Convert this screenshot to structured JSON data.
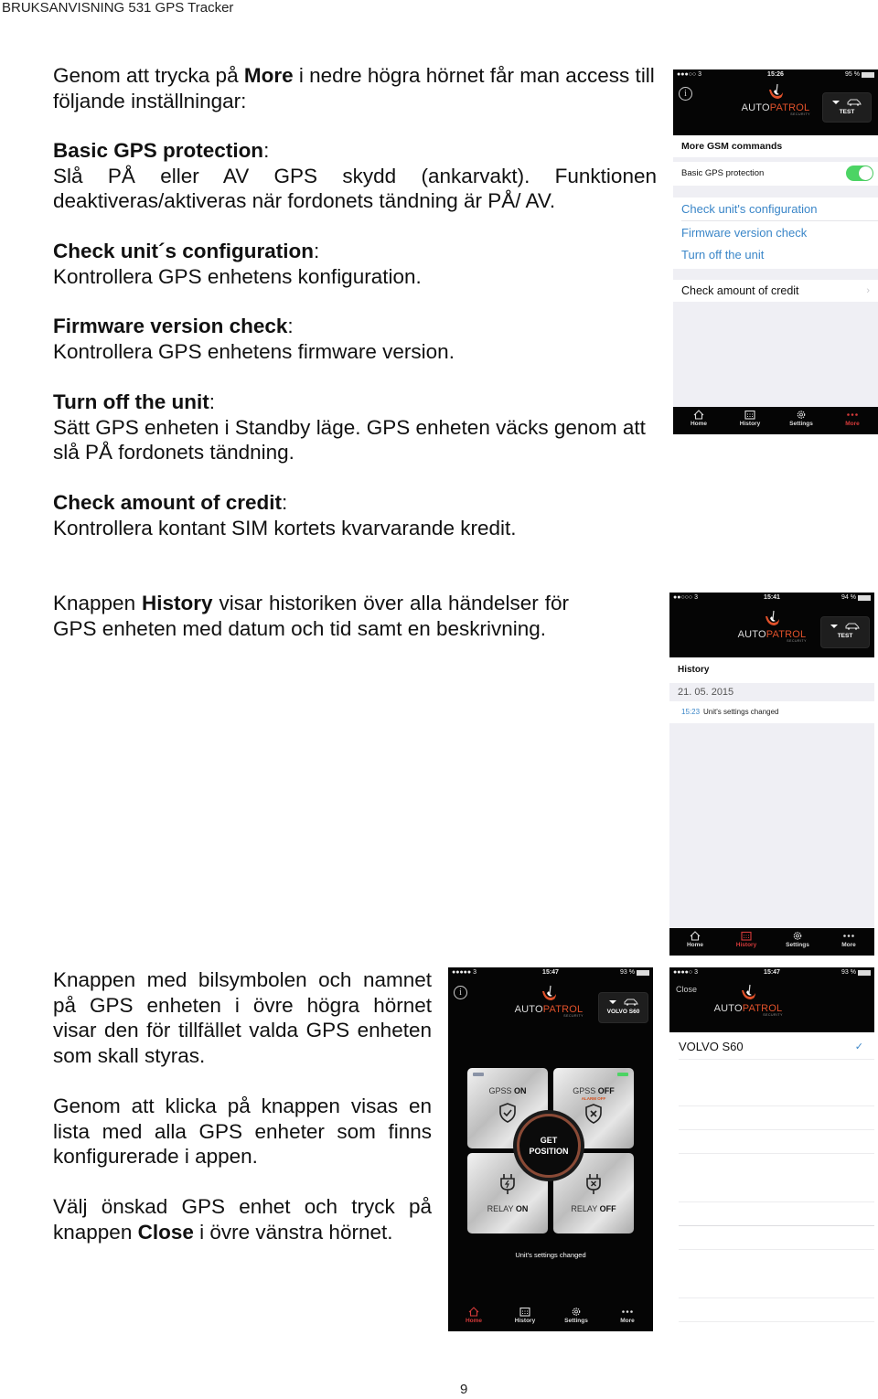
{
  "document": {
    "header": "BRUKSANVISNING 531 GPS Tracker",
    "page_number": "9"
  },
  "intro": {
    "pre": "Genom att trycka på ",
    "bold": "More",
    "post": " i nedre högra hörnet får man access till följande inställningar:"
  },
  "sections": [
    {
      "title": "Basic GPS protection",
      "colon": ":",
      "body": "Slå PÅ eller AV GPS skydd (ankarvakt). Funktionen deaktiveras/aktiveras när fordonets tändning är PÅ/ AV."
    },
    {
      "title": "Check unit´s configuration",
      "colon": ":",
      "body": "Kontrollera GPS enhetens konfiguration."
    },
    {
      "title": "Firmware version check",
      "colon": ":",
      "body": "Kontrollera GPS enhetens firmware version."
    },
    {
      "title": "Turn off the unit",
      "colon": ":",
      "body": "Sätt GPS enheten i Standby läge. GPS enheten väcks genom att slå PÅ fordonets tändning."
    },
    {
      "title": "Check amount of credit",
      "colon": ":",
      "body": "Kontrollera kontant SIM kortets kvarvarande kredit."
    }
  ],
  "history_para": {
    "pre": "Knappen ",
    "bold": "History",
    "post": " visar historiken över alla händelser för GPS enheten med datum och tid samt en beskrivning."
  },
  "unit_paras": [
    {
      "text": "Knappen med bilsymbolen och namnet på GPS enheten i övre högra hörnet visar den för tillfället valda GPS enheten som skall styras."
    },
    {
      "text": "Genom att klicka på knappen visas en lista med alla GPS enheter som finns konfigurerade i appen."
    },
    {
      "pre": "Välj önskad GPS enhet och tryck på knappen ",
      "bold": "Close",
      "post": " i övre vänstra hörnet."
    }
  ],
  "app": {
    "brand_auto": "AUTO",
    "brand_patrol": "PATROL",
    "brand_sub": "SECURITY",
    "info_label": "i",
    "accent_color": "#e0512a",
    "active_tab_color": "#d53a3a",
    "link_color": "#3a86c8",
    "toggle_color": "#4cd464",
    "tabs": [
      "Home",
      "History",
      "Settings",
      "More"
    ]
  },
  "screen_more": {
    "status": {
      "signal": "●●●○○ 3",
      "time": "15:26",
      "battery": "95 %"
    },
    "unit_name": "TEST",
    "section_header": "More GSM commands",
    "toggle_row": {
      "label": "Basic GPS protection",
      "on": true
    },
    "commands": [
      "Check unit's configuration",
      "Firmware version check",
      "Turn off the unit"
    ],
    "credit_row": "Check amount of credit",
    "active_tab": "More"
  },
  "screen_history": {
    "status": {
      "signal": "●●○○○ 3",
      "time": "15:41",
      "battery": "94 %"
    },
    "unit_name": "TEST",
    "title": "History",
    "date": "21. 05. 2015",
    "events": [
      {
        "time": "15:23",
        "text": "Unit's settings changed"
      }
    ],
    "active_tab": "History"
  },
  "screen_home": {
    "status": {
      "signal": "●●●●● 3",
      "time": "15:47",
      "battery": "93 %"
    },
    "unit_name": "VOLVO S60",
    "tiles": {
      "gpss_on": {
        "prefix": "GPSS ",
        "state": "ON"
      },
      "gpss_off": {
        "prefix": "GPSS ",
        "state": "OFF",
        "sub": "ALARM OFF"
      },
      "relay_on": {
        "prefix": "RELAY ",
        "state": "ON"
      },
      "relay_off": {
        "prefix": "RELAY ",
        "state": "OFF"
      }
    },
    "get_position": [
      "GET",
      "POSITION"
    ],
    "status_message": "Unit's settings changed",
    "active_tab": "Home"
  },
  "screen_units": {
    "status": {
      "signal": "●●●●○ 3",
      "time": "15:47",
      "battery": "93 %"
    },
    "close_label": "Close",
    "units": [
      {
        "name": "VOLVO S60",
        "selected": true
      }
    ],
    "check_glyph": "✓"
  }
}
